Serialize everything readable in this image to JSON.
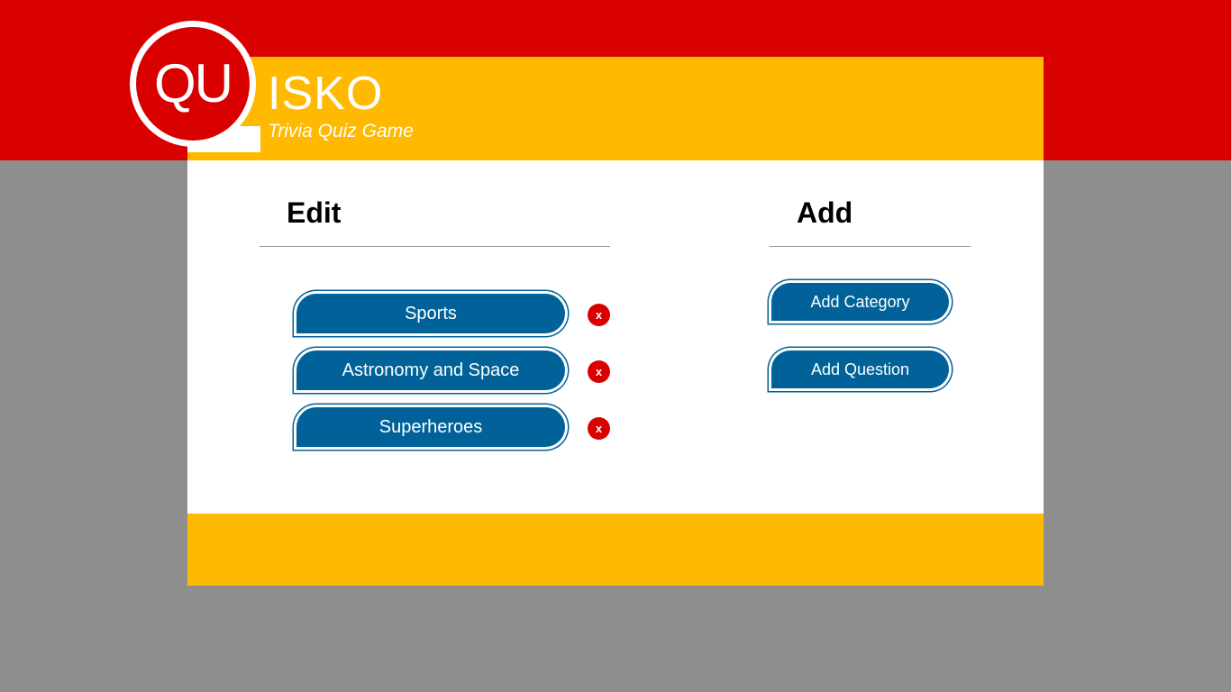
{
  "brand": {
    "logo_mark": "QU",
    "name": "ISKO",
    "tagline": "Trivia Quiz Game"
  },
  "edit": {
    "title": "Edit",
    "categories": [
      {
        "label": "Sports",
        "delete_label": "x"
      },
      {
        "label": "Astronomy and Space",
        "delete_label": "x"
      },
      {
        "label": "Superheroes",
        "delete_label": "x"
      }
    ]
  },
  "add": {
    "title": "Add",
    "add_category_label": "Add Category",
    "add_question_label": "Add Question"
  },
  "colors": {
    "brand_red": "#d90000",
    "brand_yellow": "#ffb900",
    "button_blue": "#006299",
    "background_gray": "#8e8e8e"
  }
}
